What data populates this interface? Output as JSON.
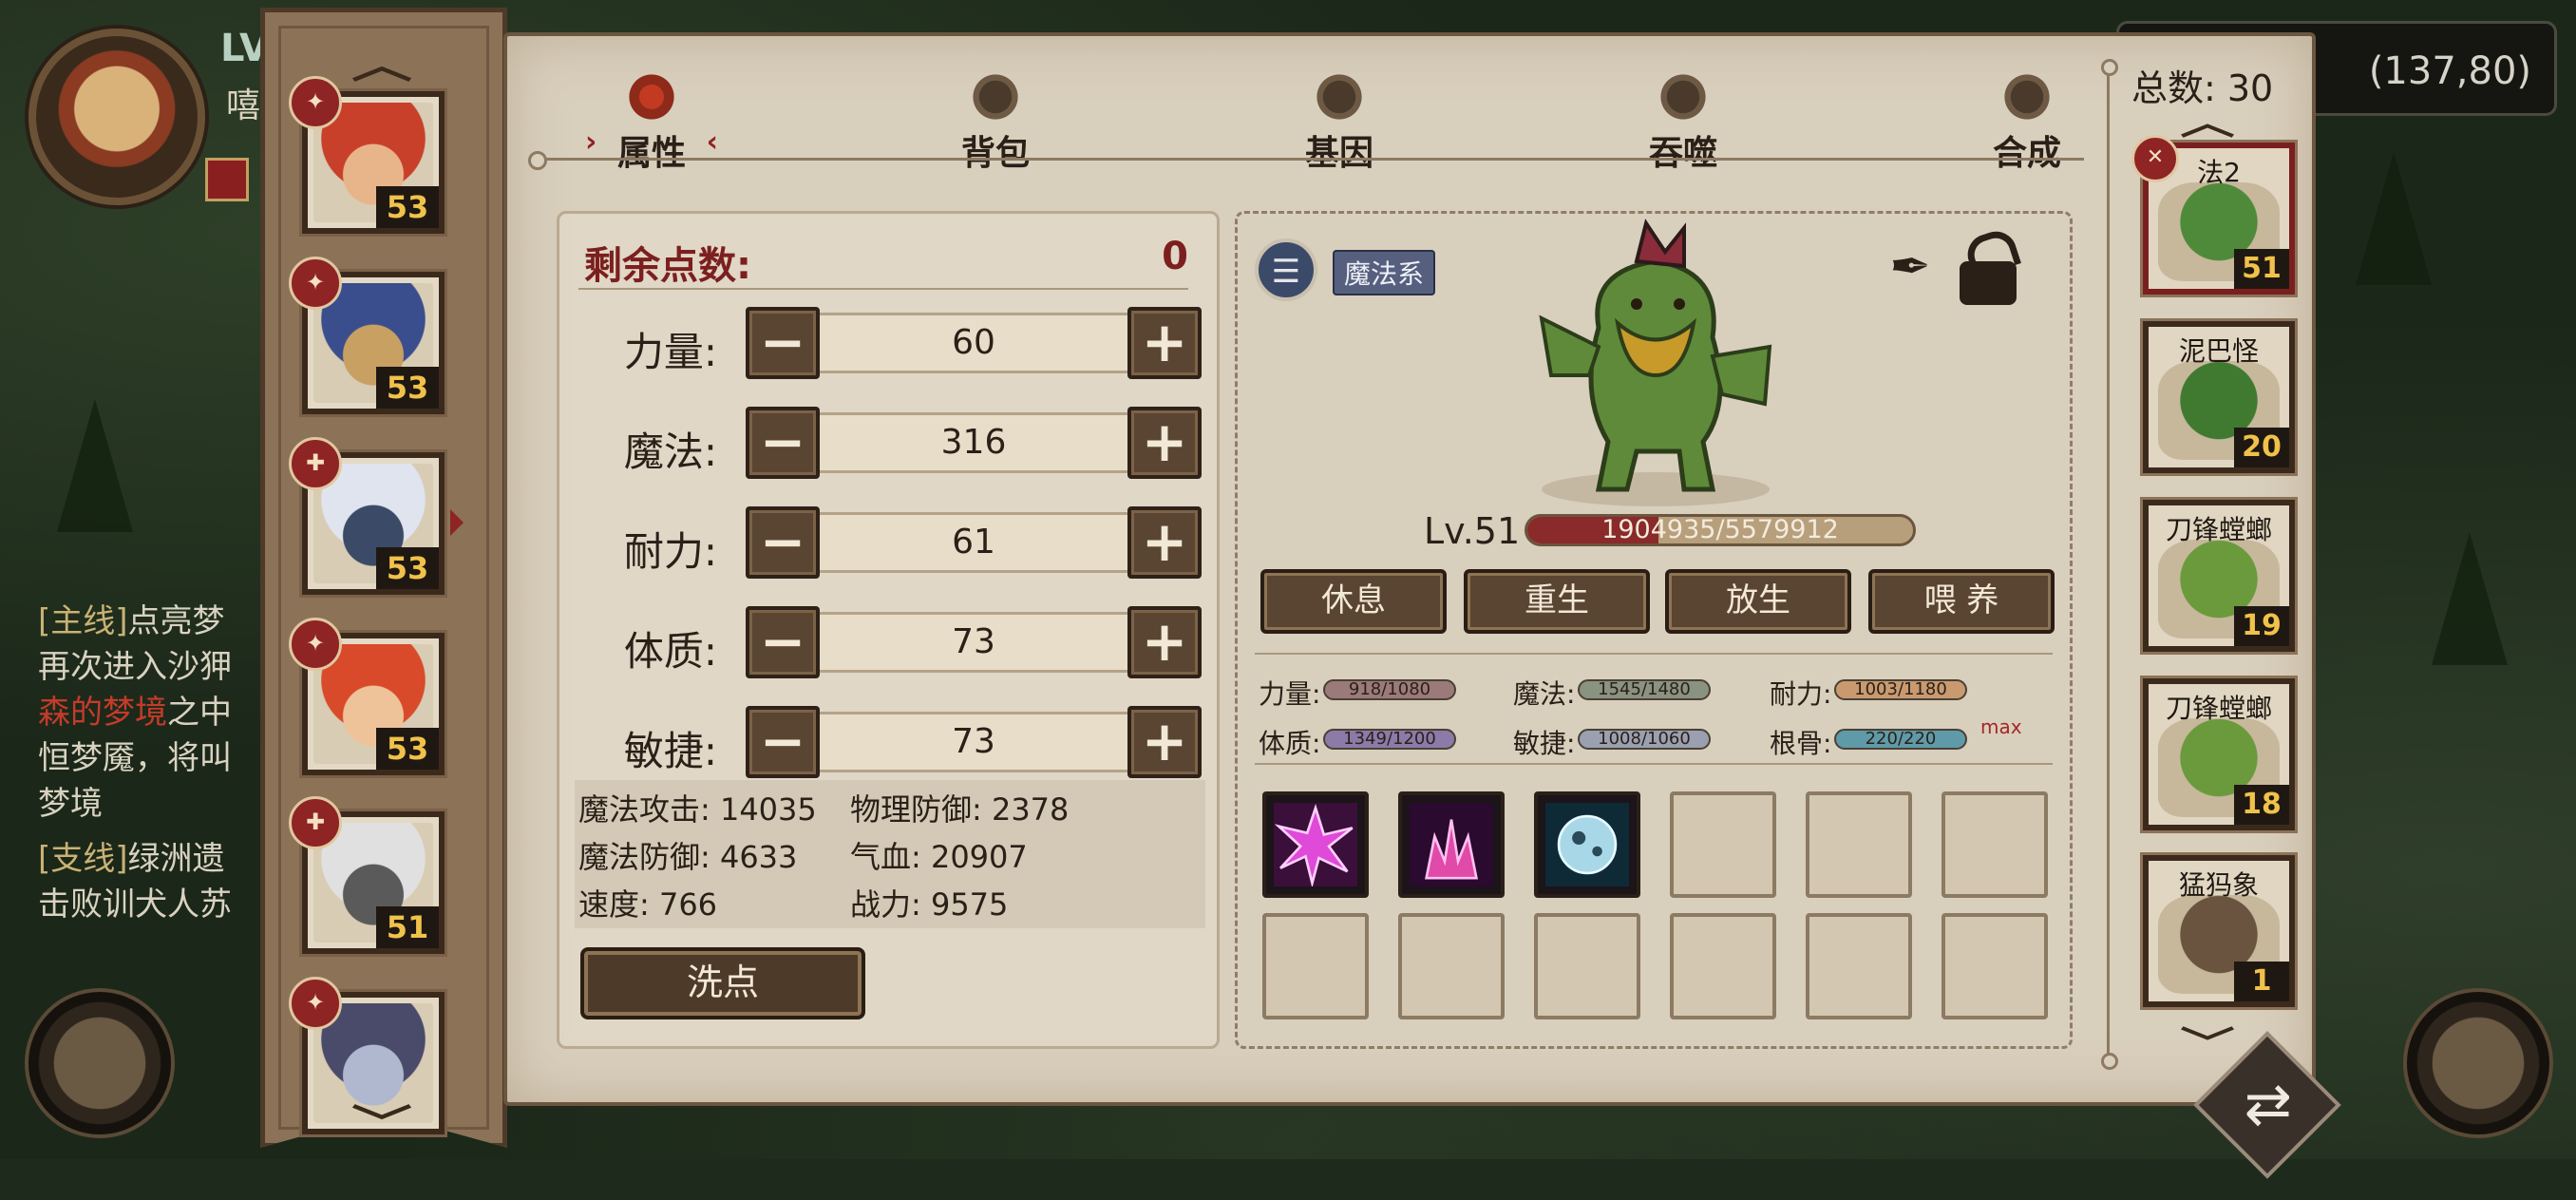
{
  "hud": {
    "level_prefix": "LV",
    "player_name_partial": "嘻",
    "coordinates": "(137,80)"
  },
  "quests": [
    {
      "tag": "[主线]",
      "title": "点亮梦"
    },
    {
      "line1": "再次进入沙狎",
      "red": "森的梦境",
      "line2": "之中",
      "line3": "恒梦魇，将叫",
      "line4": "梦境"
    },
    {
      "tag": "[支线]",
      "title": "绿洲遗"
    },
    {
      "line1": "击败训犬人苏"
    }
  ],
  "heroes": [
    {
      "level": "53",
      "badge": "✦",
      "hair": "#c8402a",
      "skin": "#e8b48a"
    },
    {
      "level": "53",
      "badge": "✦",
      "hair": "#3a4e8e",
      "skin": "#c8a062"
    },
    {
      "level": "53",
      "badge": "✚",
      "hair": "#dfe4ee",
      "skin": "#3b4a66"
    },
    {
      "level": "53",
      "badge": "✦",
      "hair": "#d84a2a",
      "skin": "#eec39a"
    },
    {
      "level": "51",
      "badge": "✚",
      "hair": "#e0e0e0",
      "skin": "#5a5a5a"
    },
    {
      "level": "",
      "badge": "✦",
      "hair": "#4a4a6a",
      "skin": "#b0b8d0"
    }
  ],
  "tabs": [
    {
      "label": "属性",
      "icon": "flame-icon",
      "active": true
    },
    {
      "label": "背包",
      "icon": "bag-icon",
      "active": false
    },
    {
      "label": "基因",
      "icon": "gene-icon",
      "active": false
    },
    {
      "label": "吞噬",
      "icon": "devour-icon",
      "active": false
    },
    {
      "label": "合成",
      "icon": "synthesis-icon",
      "active": false
    }
  ],
  "tab_arrows": {
    "left": "›",
    "right": "‹"
  },
  "points": {
    "label": "剩余点数:",
    "value": "0"
  },
  "stats": [
    {
      "label": "力量:",
      "value": "60"
    },
    {
      "label": "魔法:",
      "value": "316"
    },
    {
      "label": "耐力:",
      "value": "61"
    },
    {
      "label": "体质:",
      "value": "73"
    },
    {
      "label": "敏捷:",
      "value": "73"
    }
  ],
  "buttons": {
    "minus": "−",
    "plus": "+",
    "wash": "洗点"
  },
  "derived": {
    "magic_attack": "魔法攻击: 14035",
    "phys_defense": "物理防御: 2378",
    "magic_defense": "魔法防御: 4633",
    "hp": "气血: 20907",
    "speed": "速度: 766",
    "power": "战力: 9575"
  },
  "pet": {
    "type_label": "魔法系",
    "type_icon_glyph": "☰",
    "pen_glyph": "✒",
    "level": "Lv.51",
    "hp_text": "1904935/5579912",
    "hp_fraction": 0.341,
    "actions": [
      "休息",
      "重生",
      "放生",
      "喂 养"
    ],
    "stats": [
      {
        "label": "力量:",
        "value": "918/1080",
        "color": "#9b7a7a"
      },
      {
        "label": "魔法:",
        "value": "1545/1480",
        "color": "#8a9280"
      },
      {
        "label": "耐力:",
        "value": "1003/1180",
        "color": "#c99a70"
      },
      {
        "label": "体质:",
        "value": "1349/1200",
        "color": "#8c7aa8"
      },
      {
        "label": "敏捷:",
        "value": "1008/1060",
        "color": "#9aa0b0"
      },
      {
        "label": "根骨:",
        "value": "220/220",
        "color": "#5f9aa8"
      }
    ],
    "max_tag": "max",
    "skills": [
      "star-burst",
      "flame-burst",
      "water-orb"
    ]
  },
  "pet_list": {
    "total_label": "总数: 30",
    "items": [
      {
        "name": "法2",
        "level": "51",
        "color": "#4f8a3a",
        "active": true
      },
      {
        "name": "泥巴怪",
        "level": "20",
        "color": "#3f7a30",
        "active": false
      },
      {
        "name": "刀锋螳螂",
        "level": "19",
        "color": "#6a9a3c",
        "active": false
      },
      {
        "name": "刀锋螳螂",
        "level": "18",
        "color": "#6a9a3c",
        "active": false
      },
      {
        "name": "猛犸象",
        "level": "1",
        "color": "#6a5440",
        "active": false
      }
    ]
  },
  "swap_glyph": "⇄"
}
